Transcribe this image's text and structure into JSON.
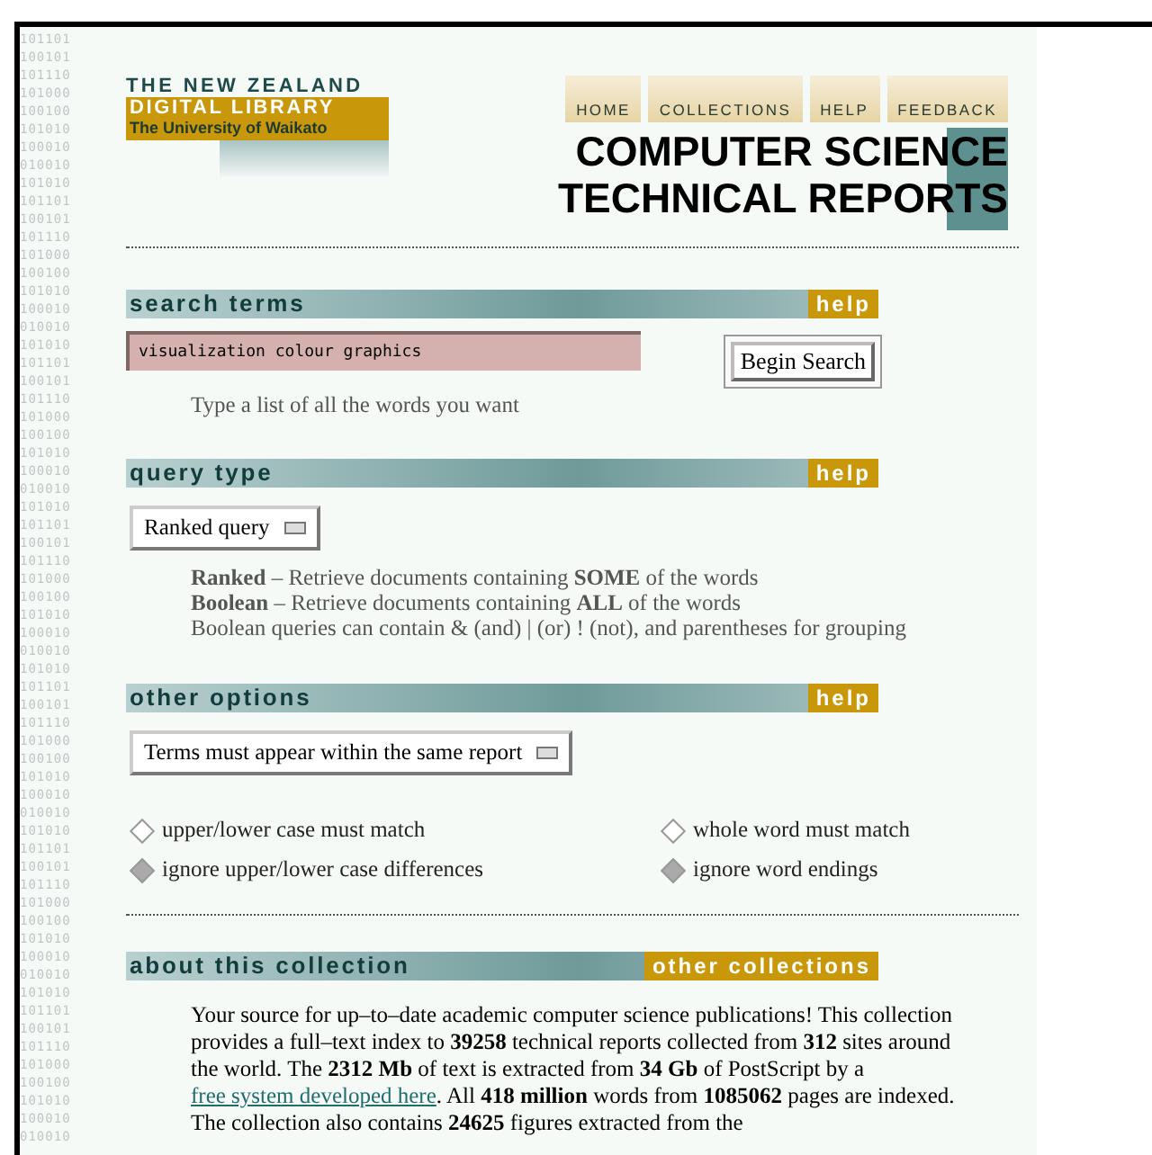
{
  "binary_column": [
    "101101",
    "100101",
    "101110",
    "101000",
    "100100",
    "101010",
    "100010",
    "010010",
    "101010",
    "101101",
    "100101",
    "101110",
    "101000",
    "100100",
    "101010",
    "100010",
    "010010",
    "101010",
    "101101",
    "100101",
    "101110",
    "101000",
    "100100",
    "101010",
    "100010",
    "010010",
    "101010",
    "101101",
    "100101",
    "101110",
    "101000",
    "100100",
    "101010",
    "100010",
    "010010",
    "101010",
    "101101",
    "100101",
    "101110",
    "101000",
    "100100",
    "101010",
    "100010",
    "010010",
    "101010",
    "101101",
    "100101",
    "101110",
    "101000",
    "100100",
    "101010",
    "100010",
    "010010",
    "101010",
    "101101",
    "100101",
    "101110",
    "101000",
    "100100",
    "101010",
    "100010",
    "010010"
  ],
  "logo": {
    "line_1": "THE NEW ZEALAND",
    "line_2": "DIGITAL LIBRARY",
    "line_3": "The University of Waikato"
  },
  "nav": [
    "HOME",
    "COLLECTIONS",
    "HELP",
    "FEEDBACK"
  ],
  "title": [
    "COMPUTER SCIENCE",
    "TECHNICAL REPORTS"
  ],
  "search_terms": {
    "heading": "search terms",
    "help": "help",
    "value": "visualization colour graphics",
    "button": "Begin Search",
    "hint": "Type a list of all the words you want"
  },
  "query_type": {
    "heading": "query type",
    "help": "help",
    "dropdown": "Ranked query",
    "notes": [
      "**Ranked** – Retrieve documents containing **SOME** of the words",
      "**Boolean** – Retrieve documents containing **ALL** of the words",
      "Boolean queries can contain & (and) | (or) ! (not), and parentheses for grouping"
    ]
  },
  "other_options": {
    "heading": "other options",
    "help": "help",
    "dropdown": "Terms must appear within the same report",
    "radio_groups": [
      [
        {
          "label": "upper/lower case must match",
          "selected": false
        },
        {
          "label": "ignore upper/lower case differences",
          "selected": true
        }
      ],
      [
        {
          "label": "whole word must match",
          "selected": false
        },
        {
          "label": "ignore word endings",
          "selected": true
        }
      ]
    ]
  },
  "about": {
    "heading": "about this collection",
    "other": "other collections",
    "text_before": "Your source for up–to–date academic computer science publications! This collection provides a full–text index to **39258** technical reports collected from **312** sites around the world. The **2312 Mb** of text is extracted from **34 Gb** of PostScript by a ",
    "link": "free system developed here",
    "text_after": ". All **418 million** words from **1085062** pages are indexed. The collection also contains **24625** figures extracted from the"
  }
}
